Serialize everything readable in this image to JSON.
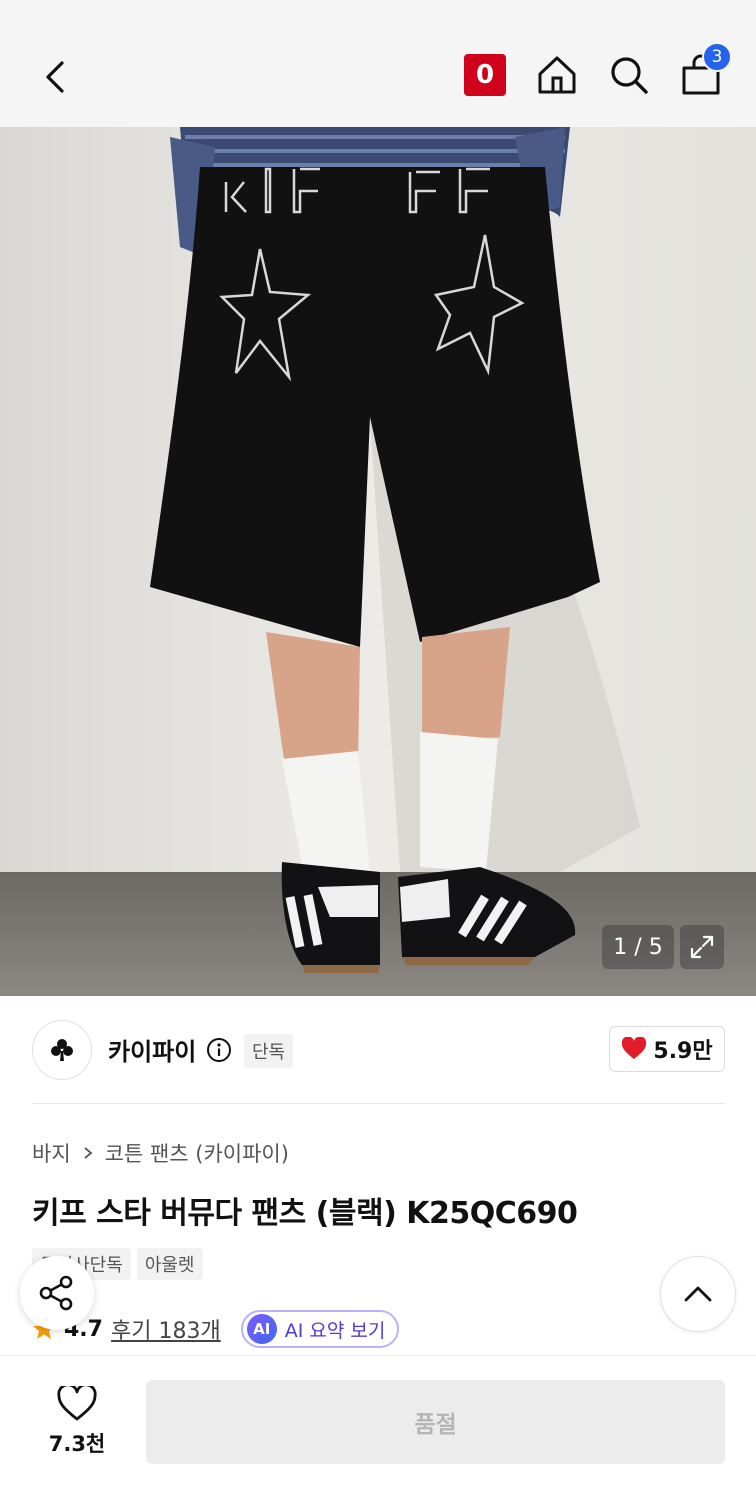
{
  "header": {
    "logo_text": "0",
    "cart_count": "3",
    "icons": [
      "back-icon",
      "logo-icon",
      "home-icon",
      "search-icon",
      "cart-icon"
    ]
  },
  "gallery": {
    "counter": "1 / 5",
    "icons": [
      "expand-icon"
    ]
  },
  "brand": {
    "name": "카이파이",
    "exclusive_tag": "단독",
    "like_count": "5.9만",
    "icons": [
      "brand-logo-club-icon",
      "info-icon",
      "heart-icon"
    ]
  },
  "product": {
    "breadcrumb": [
      "바지",
      "코튼 팬츠 (카이파이)"
    ],
    "title": "키프 스타 버뮤다 팬츠 (블랙) K25QC690",
    "tags": [
      "무신사단독",
      "아울렛"
    ],
    "rating": "4.7",
    "review_text": "후기 183개",
    "ai_badge": "AI",
    "ai_summary": "AI 요약 보기"
  },
  "fabs": {
    "icons": [
      "share-icon",
      "chevron-up-icon"
    ]
  },
  "bottom": {
    "wish_count": "7.3천",
    "buy_button": "품절"
  },
  "colors": {
    "brand_red": "#d0021b",
    "badge_blue": "#2563eb",
    "like_red": "#e11d2a",
    "star_orange": "#f59e0b",
    "ai_purple": "#4f3bd6"
  }
}
